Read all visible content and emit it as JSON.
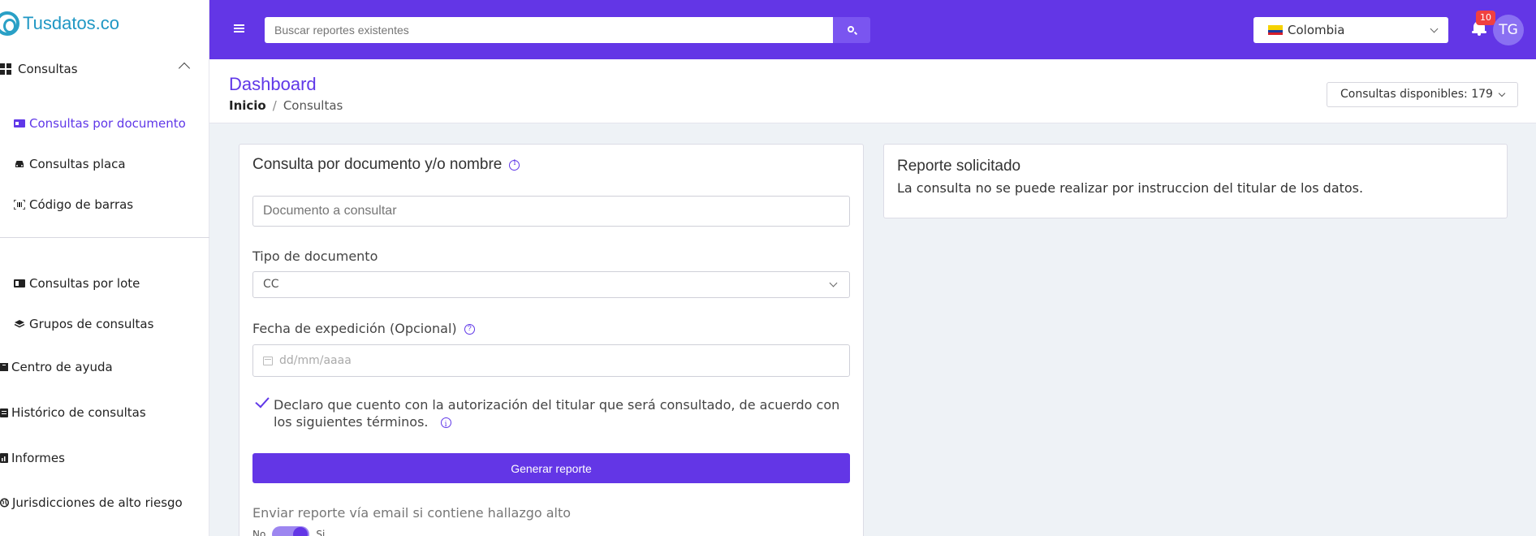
{
  "brand": {
    "name": "Tusdatos.co"
  },
  "sidebar": {
    "group": {
      "label": "Consultas"
    },
    "items": [
      {
        "label": "Consultas por documento"
      },
      {
        "label": "Consultas placa"
      },
      {
        "label": "Código de barras"
      },
      {
        "label": "Consultas por lote"
      },
      {
        "label": "Grupos de consultas"
      }
    ],
    "links": [
      {
        "label": "Centro de ayuda"
      },
      {
        "label": "Histórico de consultas"
      },
      {
        "label": "Informes"
      },
      {
        "label": "Jurisdicciones de alto riesgo"
      }
    ]
  },
  "topbar": {
    "search_placeholder": "Buscar reportes existentes",
    "country": "Colombia",
    "notifications": "10",
    "avatar_initials": "TG"
  },
  "header": {
    "title": "Dashboard",
    "breadcrumb": [
      "Inicio",
      "Consultas"
    ],
    "available": "Consultas disponibles: 179"
  },
  "form": {
    "title": "Consulta por documento y/o nombre",
    "document_placeholder": "Documento a consultar",
    "doc_type_label": "Tipo de documento",
    "doc_type_value": "CC",
    "date_label": "Fecha de expedición (Opcional)",
    "date_placeholder": "dd/mm/aaaa",
    "declaration": "Declaro que cuento con la autorización del titular que será consultado, de acuerdo con los siguientes términos.",
    "submit": "Generar reporte",
    "email_label": "Enviar reporte vía email si contiene hallazgo alto",
    "toggle_no": "No",
    "toggle_yes": "Si"
  },
  "report": {
    "title": "Reporte solicitado",
    "message": "La consulta no se puede realizar por instruccion del titular de los datos."
  },
  "colors": {
    "primary": "#6336e6",
    "brand": "#1f97c4",
    "badge": "#f04040"
  }
}
